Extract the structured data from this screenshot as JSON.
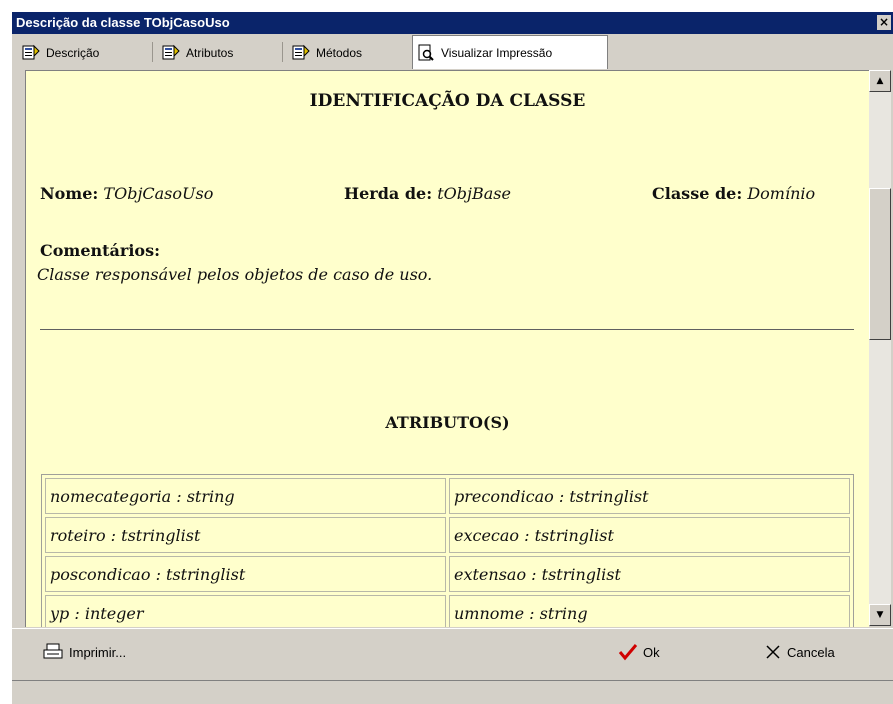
{
  "window": {
    "title": "Descrição da classe TObjCasoUso",
    "close_glyph": "×"
  },
  "tabs": [
    {
      "label": "Descrição",
      "icon": "class-doc-icon",
      "active": false
    },
    {
      "label": "Atributos",
      "icon": "class-doc-icon",
      "active": false
    },
    {
      "label": "Métodos",
      "icon": "class-doc-icon",
      "active": false
    },
    {
      "label": "Visualizar Impressão",
      "icon": "print-preview-icon",
      "active": true
    }
  ],
  "document": {
    "heading": "IDENTIFICAÇÃO DA CLASSE",
    "nome_label": "Nome:",
    "nome_value": "TObjCasoUso",
    "herda_label": "Herda de:",
    "herda_value": "tObjBase",
    "classe_label": "Classe de:",
    "classe_value": "Domínio",
    "comentarios_label": "Comentários:",
    "comentarios_text": "Classe responsável pelos objetos de caso de uso.",
    "atributos_heading": "ATRIBUTO(S)",
    "attributes": [
      [
        "nomecategoria : string",
        "precondicao : tstringlist"
      ],
      [
        "roteiro : tstringlist",
        "excecao : tstringlist"
      ],
      [
        "poscondicao : tstringlist",
        "extensao : tstringlist"
      ],
      [
        "yp : integer",
        "umnome : string"
      ]
    ]
  },
  "buttons": {
    "print_label": "Imprimir...",
    "ok_label": "Ok",
    "cancel_label": "Cancela"
  },
  "colors": {
    "titlebar": "#0a246a",
    "content_bg": "#ffffcc",
    "ok_check": "#d00000",
    "window_face": "#d4d0c8"
  }
}
